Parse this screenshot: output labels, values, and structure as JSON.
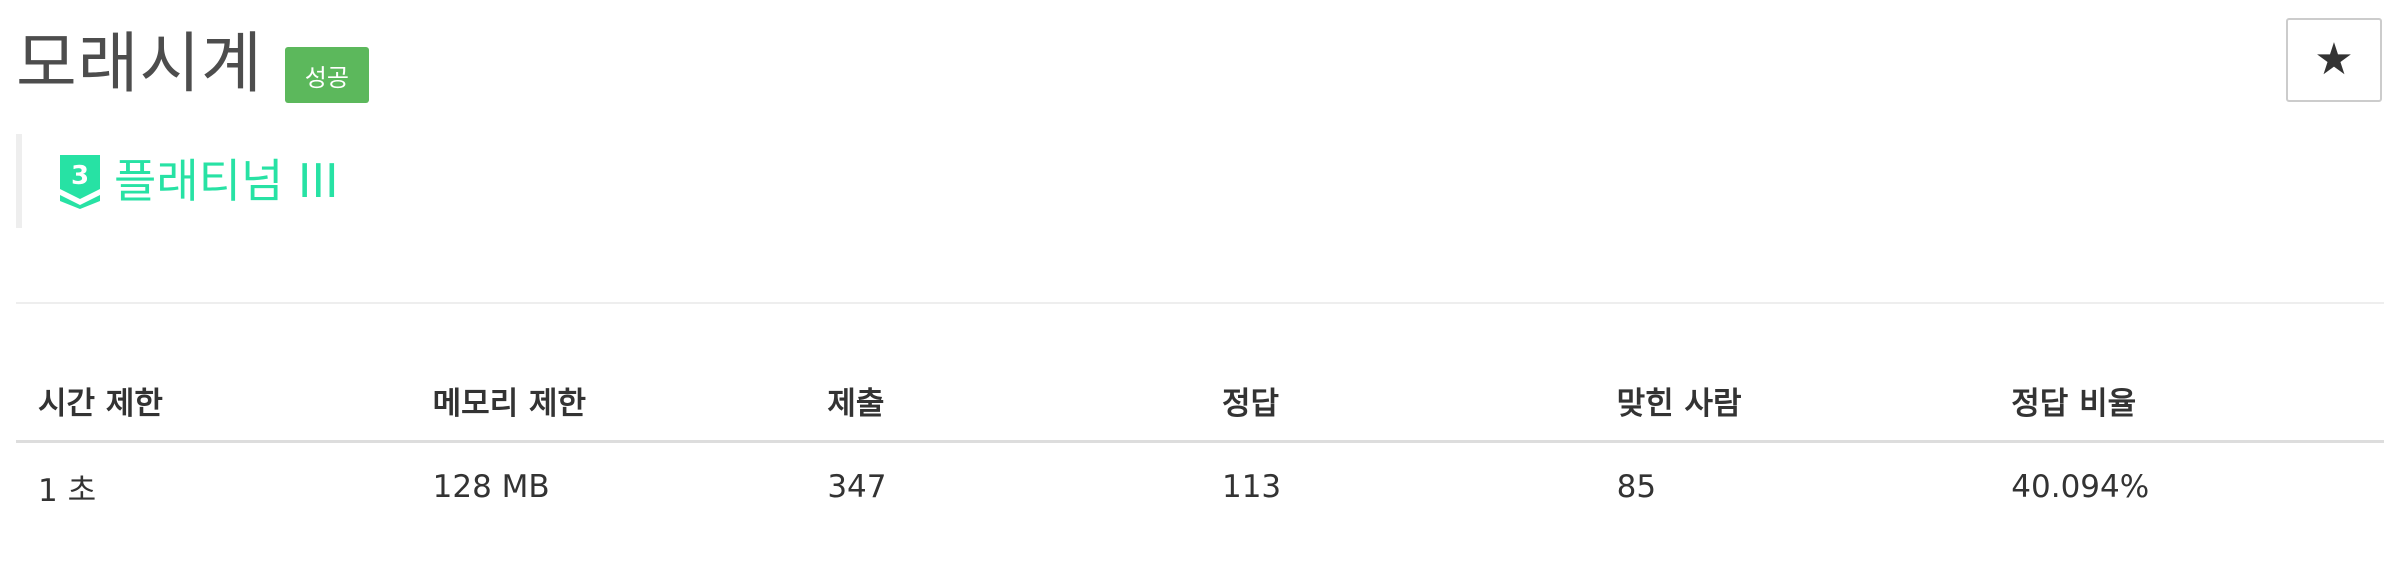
{
  "problem": {
    "title": "모래시계",
    "result_badge": "성공",
    "tier": {
      "level_number": "3",
      "name": "플래티넘 III",
      "color": "#27e2a4",
      "icon": "platinum-tier-icon"
    },
    "star_icon": "★"
  },
  "colors": {
    "success_badge": "#5cb85c",
    "tier_platinum": "#27e2a4"
  },
  "stats": {
    "headers": [
      "시간 제한",
      "메모리 제한",
      "제출",
      "정답",
      "맞힌 사람",
      "정답 비율"
    ],
    "values": [
      "1 초",
      "128 MB",
      "347",
      "113",
      "85",
      "40.094%"
    ]
  }
}
